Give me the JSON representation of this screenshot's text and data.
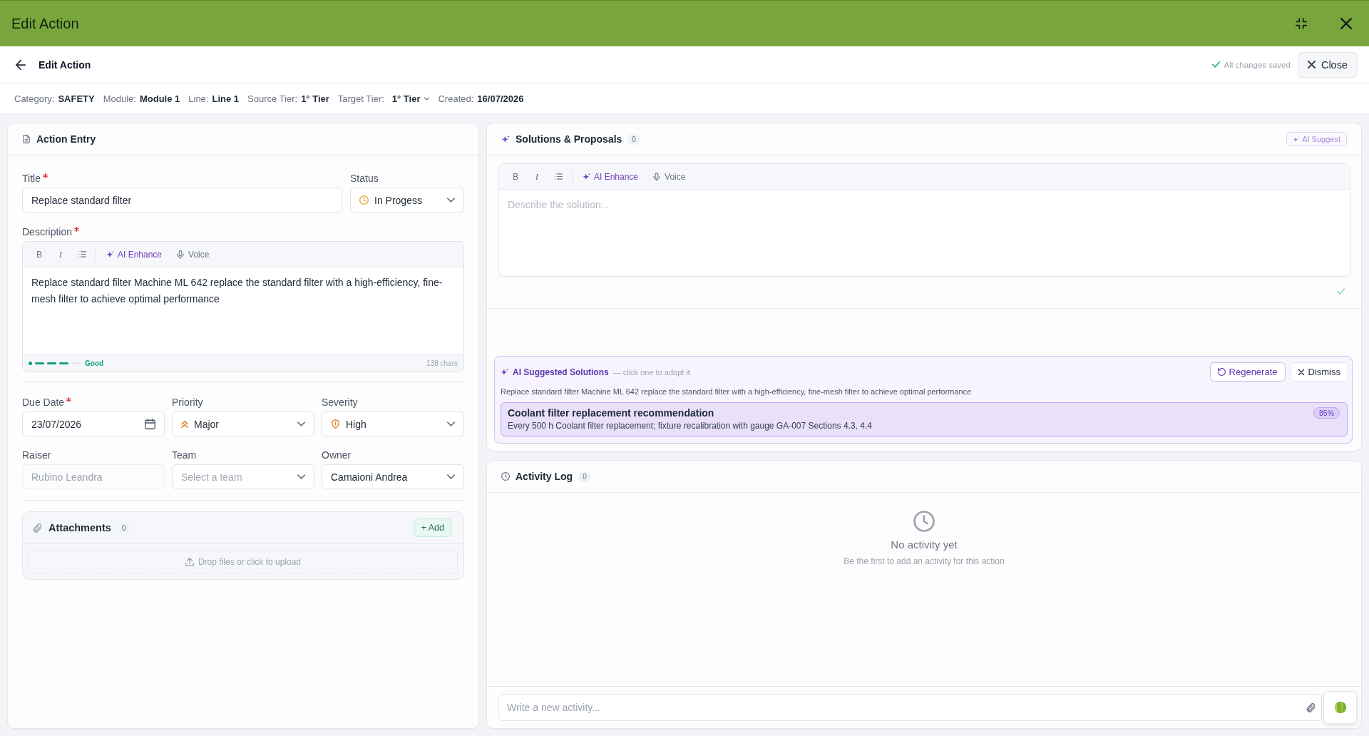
{
  "window": {
    "title": "Edit Action"
  },
  "header": {
    "title": "Edit Action",
    "save_status": "All changes saved",
    "close_button": "Close"
  },
  "meta": [
    {
      "label": "Category:",
      "value": "SAFETY",
      "kind": "text"
    },
    {
      "label": "Module:",
      "value": "Module 1",
      "kind": "text"
    },
    {
      "label": "Line:",
      "value": "Line 1",
      "kind": "text"
    },
    {
      "label": "Source Tier:",
      "value": "1° Tier",
      "kind": "text"
    },
    {
      "label": "Target Tier:",
      "value": "1° Tier",
      "kind": "dropdown"
    },
    {
      "label": "Created:",
      "value": "16/07/2026",
      "kind": "text"
    }
  ],
  "action_entry": {
    "title": "Action Entry",
    "title_field": {
      "label": "Title",
      "required": true,
      "value": "Replace standard filter"
    },
    "status": {
      "label": "Status",
      "value": "In Progess"
    },
    "description": {
      "label": "Description",
      "required": true,
      "toolbar": [
        {
          "kind": "bold",
          "label": "B"
        },
        {
          "kind": "italic",
          "label": "I"
        },
        {
          "kind": "list"
        },
        {
          "kind": "separator"
        },
        {
          "kind": "ai",
          "label": "AI Enhance"
        },
        {
          "kind": "voice",
          "label": "Voice"
        }
      ],
      "text": "Replace standard filter Machine ML 642 replace the standard filter with a high-efficiency, fine-mesh filter to achieve optimal performance",
      "quality": {
        "level": 0.8,
        "label": "Good"
      },
      "char_count": "138 chars"
    },
    "due_date": {
      "label": "Due Date",
      "required": true,
      "value": "23/07/2026"
    },
    "priority": {
      "label": "Priority",
      "value": "Major"
    },
    "severity": {
      "label": "Severity",
      "value": "High"
    },
    "raiser": {
      "label": "Raiser",
      "value": "Rubino Leandra",
      "disabled": true
    },
    "team": {
      "label": "Team",
      "placeholder": "Select a team"
    },
    "owner": {
      "label": "Owner",
      "value": "Camaioni Andrea"
    },
    "attachments": {
      "title": "Attachments",
      "count": "0",
      "add_button": "+ Add",
      "dropzone": "Drop files or click to upload"
    }
  },
  "solutions": {
    "title": "Solutions & Proposals",
    "count": "0",
    "ai_suggest_button": "AI Suggest",
    "toolbar": [
      {
        "kind": "bold",
        "label": "B"
      },
      {
        "kind": "italic",
        "label": "I"
      },
      {
        "kind": "list"
      },
      {
        "kind": "separator"
      },
      {
        "kind": "ai",
        "label": "AI Enhance"
      },
      {
        "kind": "voice",
        "label": "Voice"
      }
    ],
    "placeholder": "Describe the solution...",
    "saved": true,
    "ai_suggestions": {
      "title": "AI Suggested Solutions",
      "hint": "— click one to adopt it",
      "regenerate_button": "Regenerate",
      "dismiss_button": "Dismiss",
      "context": "Replace standard filter Machine ML 642 replace the standard filter with a high-efficiency, fine-mesh filter to achieve optimal performance",
      "items": [
        {
          "title": "Coolant filter replacement recommendation",
          "text": "Every 500 h Coolant filter replacement; fixture recalibration with gauge GA-007 Sections 4.3, 4.4",
          "confidence": "85%",
          "selected": true
        }
      ]
    }
  },
  "activity_log": {
    "title": "Activity Log",
    "count": "0",
    "empty_title": "No activity yet",
    "empty_text": "Be the first to add an activity for this action",
    "placeholder": "Write a new activity..."
  }
}
